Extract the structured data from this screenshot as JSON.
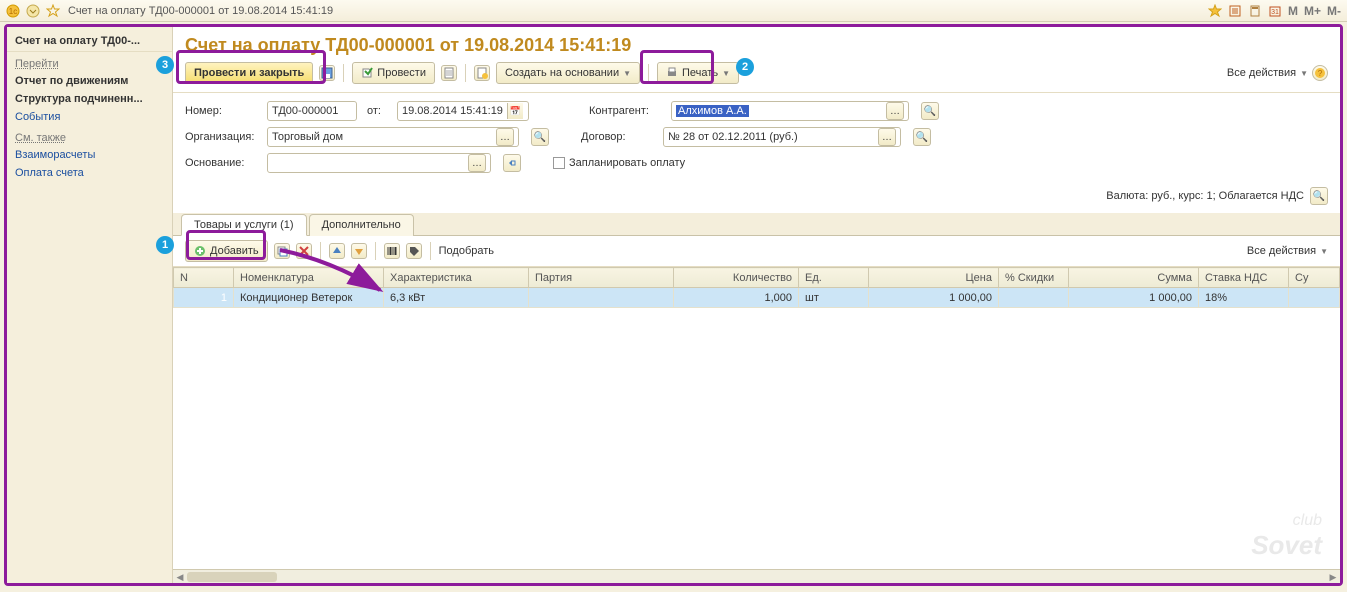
{
  "window": {
    "title": "Счет на оплату ТД00-000001 от 19.08.2014 15:41:19",
    "m_letters": [
      "M",
      "M+",
      "M-"
    ]
  },
  "sidebar": {
    "title": "Счет на оплату ТД00-...",
    "goto_label": "Перейти",
    "links1": [
      "Отчет по движениям",
      "Структура подчиненн..."
    ],
    "link_events": "События",
    "see_also_label": "См. также",
    "links2": [
      "Взаиморасчеты",
      "Оплата счета"
    ]
  },
  "doc": {
    "title": "Счет на оплату ТД00-000001 от 19.08.2014 15:41:19",
    "toolbar": {
      "post_close": "Провести и закрыть",
      "post": "Провести",
      "create_based": "Создать на основании",
      "print": "Печать",
      "all_actions": "Все действия"
    },
    "fields": {
      "number_label": "Номер:",
      "number_value": "ТД00-000001",
      "date_label": "от:",
      "date_value": "19.08.2014 15:41:19",
      "kontr_label": "Контрагент:",
      "kontr_value": "Алхимов А.А.",
      "org_label": "Организация:",
      "org_value": "Торговый дом",
      "dogovor_label": "Договор:",
      "dogovor_value": "№ 28 от 02.12.2011 (руб.)",
      "osnov_label": "Основание:",
      "osnov_value": "",
      "plan_pay": "Запланировать оплату"
    },
    "summary": "Валюта: руб., курс: 1; Облагается НДС",
    "tabs": {
      "goods": "Товары и услуги (1)",
      "additional": "Дополнительно"
    },
    "grid_toolbar": {
      "add": "Добавить",
      "pick": "Подобрать",
      "all_actions": "Все действия"
    },
    "grid": {
      "headers": [
        "N",
        "Номенклатура",
        "Характеристика",
        "Партия",
        "Количество",
        "Ед.",
        "Цена",
        "% Скидки",
        "Сумма",
        "Ставка НДС",
        "Су"
      ],
      "rows": [
        {
          "n": "1",
          "nomen": "Кондиционер Ветерок",
          "char": "6,3 кВт",
          "party": "",
          "qty": "1,000",
          "unit": "шт",
          "price": "1 000,00",
          "discount": "",
          "sum": "1 000,00",
          "vat": "18%"
        }
      ]
    }
  },
  "watermark": {
    "club": "club",
    "sovet": "Sovet"
  }
}
